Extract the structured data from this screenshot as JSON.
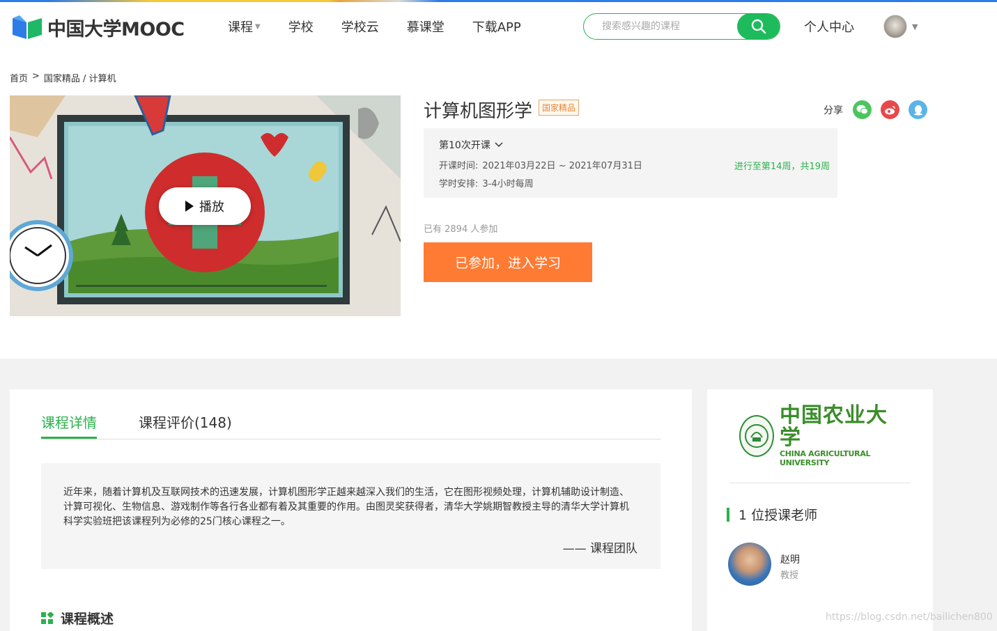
{
  "header": {
    "logo_text": "中国大学MOOC",
    "nav": [
      {
        "label": "课程",
        "has_dropdown": true
      },
      {
        "label": "学校",
        "has_dropdown": false
      },
      {
        "label": "学校云",
        "has_dropdown": false
      },
      {
        "label": "慕课堂",
        "has_dropdown": false
      },
      {
        "label": "下载APP",
        "has_dropdown": false
      }
    ],
    "search_placeholder": "搜索感兴趣的课程",
    "personal_center": "个人中心"
  },
  "breadcrumb": {
    "home": "首页",
    "sep": ">",
    "category": "国家精品 / 计算机"
  },
  "cover": {
    "play_label": "播放"
  },
  "course": {
    "title": "计算机图形学",
    "badge": "国家精品",
    "share_label": "分享",
    "share_icons": [
      "wechat-icon",
      "weibo-icon",
      "qq-icon"
    ],
    "term_label": "第10次开课",
    "time_key": "开课时间:",
    "time_value": "2021年03月22日 ~ 2021年07月31日",
    "schedule_key": "学时安排:",
    "schedule_value": "3-4小时每周",
    "progress": "进行至第14周，共19周",
    "enrolled": "已有 2894 人参加",
    "enter_button": "已参加，进入学习"
  },
  "detail": {
    "tabs": [
      {
        "label": "课程详情",
        "active": true
      },
      {
        "label": "课程评价(148)",
        "active": false
      }
    ],
    "quote_text": "近年来，随着计算机及互联网技术的迅速发展，计算机图形学正越来越深入我们的生活，它在图形视频处理，计算机辅助设计制造、计算可视化、生物信息、游戏制作等各行各业都有着及其重要的作用。由图灵奖获得者，清华大学姚期智教授主导的清华大学计算机科学实验班把该课程列为必修的25门核心课程之一。",
    "quote_sign": "—— 课程团队",
    "overview_title": "课程概述"
  },
  "side": {
    "university_cn": "中国农业大学",
    "university_en": "CHINA AGRICULTURAL UNIVERSITY",
    "teacher_heading": "1 位授课老师",
    "teacher_name": "赵明",
    "teacher_title": "教授"
  },
  "watermark": "https://blog.csdn.net/bailichen800",
  "colors": {
    "brand_green": "#2bb24c",
    "button_orange": "#ff7a33",
    "badge_orange": "#e4873b"
  }
}
